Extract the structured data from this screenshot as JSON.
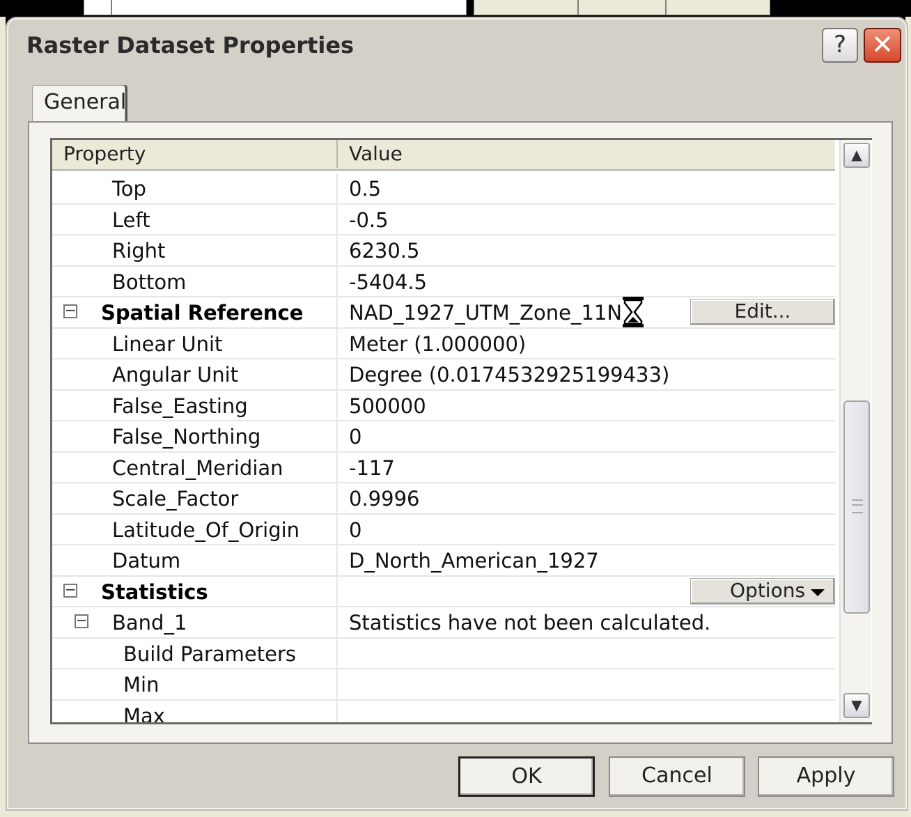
{
  "dialog": {
    "title": "Raster Dataset Properties",
    "help_label": "?",
    "close_label": "✕"
  },
  "tabs": [
    {
      "label": "General",
      "active": true
    }
  ],
  "grid": {
    "headers": {
      "property": "Property",
      "value": "Value"
    },
    "rows": [
      {
        "property": "Top",
        "value": "0.5"
      },
      {
        "property": "Left",
        "value": "-0.5"
      },
      {
        "property": "Right",
        "value": "6230.5"
      },
      {
        "property": "Bottom",
        "value": "-5404.5"
      },
      {
        "property": "Spatial Reference",
        "value": "NAD_1927_UTM_Zone_11N",
        "button": "Edit..."
      },
      {
        "property": "Linear Unit",
        "value": "Meter (1.000000)"
      },
      {
        "property": "Angular Unit",
        "value": "Degree (0.0174532925199433)"
      },
      {
        "property": "False_Easting",
        "value": "500000"
      },
      {
        "property": "False_Northing",
        "value": "0"
      },
      {
        "property": "Central_Meridian",
        "value": "-117"
      },
      {
        "property": "Scale_Factor",
        "value": "0.9996"
      },
      {
        "property": "Latitude_Of_Origin",
        "value": "0"
      },
      {
        "property": "Datum",
        "value": "D_North_American_1927"
      },
      {
        "property": "Statistics",
        "value": "",
        "button": "Options"
      },
      {
        "property": "Band_1",
        "value": "Statistics have not been calculated."
      },
      {
        "property": "Build Parameters",
        "value": ""
      },
      {
        "property": "Min",
        "value": ""
      },
      {
        "property": "Max",
        "value": ""
      }
    ]
  },
  "buttons": {
    "ok": "OK",
    "cancel": "Cancel",
    "apply": "Apply"
  },
  "icons": {
    "expander": "minus-box-icon",
    "busy": "hourglass-icon",
    "scroll_up": "chevron-up-icon",
    "scroll_down": "chevron-down-icon"
  },
  "colors": {
    "dialog_bg": "#d4d0c8",
    "panel_bg": "#f4f3ee",
    "close_red": "#d4482c"
  }
}
